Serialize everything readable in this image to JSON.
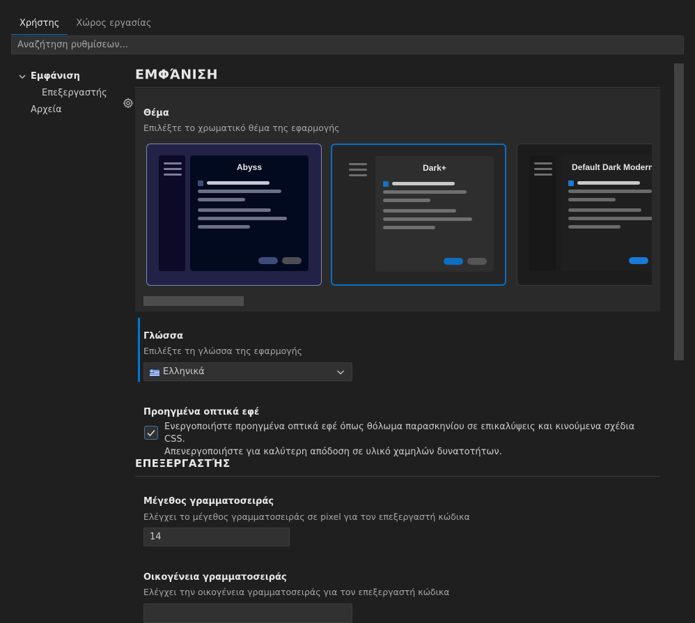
{
  "tabs": [
    {
      "label": "Χρήστης"
    },
    {
      "label": "Χώρος εργασίας"
    }
  ],
  "search": {
    "placeholder": "Αναζήτηση ρυθμίσεων..."
  },
  "tree": {
    "items": [
      {
        "label": "Εμφάνιση"
      },
      {
        "label": "Επεξεργαστής"
      },
      {
        "label": "Αρχεία"
      }
    ]
  },
  "appearance": {
    "section_title": "ΕΜΦΆΝΙΣΗ",
    "theme": {
      "title": "Θέμα",
      "description": "Επιλέξτε το χρωματικό θέμα της εφαρμογής",
      "cards": [
        {
          "name": "Abyss"
        },
        {
          "name": "Dark+"
        },
        {
          "name": "Default Dark Modern"
        }
      ],
      "selected": "Dark+"
    },
    "language": {
      "title": "Γλώσσα",
      "description": "Επιλέξτε τη γλώσσα της εφαρμογής",
      "value": "Ελληνικά"
    },
    "effects": {
      "title": "Προηγμένα οπτικά εφέ",
      "checked": true,
      "line1": "Ενεργοποιήστε προηγμένα οπτικά εφέ όπως θόλωμα παρασκηνίου σε επικαλύψεις και κινούμενα σχέδια CSS.",
      "line2": "Απενεργοποιήστε για καλύτερη απόδοση σε υλικό χαμηλών δυνατοτήτων."
    }
  },
  "editor": {
    "section_title": "ΕΠΕΞΕΡΓΑΣΤΉΣ",
    "font_size": {
      "title": "Μέγεθος γραμματοσειράς",
      "description": "Ελέγχει το μέγεθος γραμματοσειράς σε pixel για τον επεξεργαστή κώδικα",
      "value": "14"
    },
    "font_family": {
      "title": "Οικογένεια γραμματοσειράς",
      "description": "Ελέγχει την οικογένεια γραμματοσειράς για τον επεξεργαστή κώδικα"
    }
  },
  "colors": {
    "accent": "#0078d4",
    "background": "#1f1f1f",
    "panel": "#2a2a2a"
  }
}
